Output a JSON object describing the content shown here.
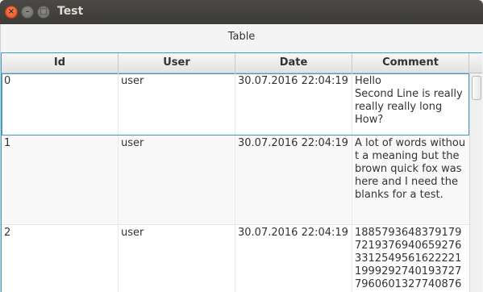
{
  "window": {
    "title": "Test"
  },
  "table_title": "Table",
  "columns": [
    "Id",
    "User",
    "Date",
    "Comment"
  ],
  "rows": [
    {
      "id": "0",
      "user": "user",
      "date": "30.07.2016 22:04:19",
      "comment": "Hello\nSecond Line is really really really long\nHow?"
    },
    {
      "id": "1",
      "user": "user",
      "date": "30.07.2016 22:04:19",
      "comment": "A lot of words without a meaning but the brown quick fox was here and I need the blanks for a test."
    },
    {
      "id": "2",
      "user": "user",
      "date": "30.07.2016 22:04:19",
      "comment": "1885793648379179\n7219376940659276\n3312549561622221\n1999292740193727\n7960601327740876"
    }
  ]
}
